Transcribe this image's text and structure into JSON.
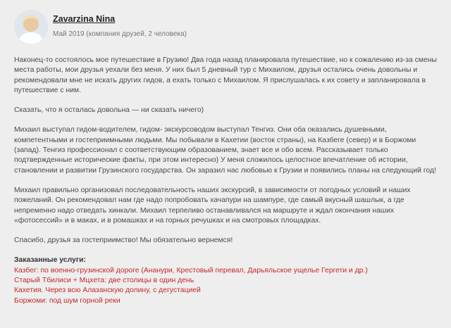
{
  "review": {
    "author": "Zavarzina Nina",
    "meta": "Май 2019 (компания друзей, 2 человека)",
    "paragraphs": [
      "Наконец-то состоялось мое путешествие в Грузию! Два года назад планировала путешествие, но к сожалению из-за смены места работы, мои друзья уехали без меня. У них был 5 дневный тур с Михаилом, друзья остались очень довольны и рекомендовали мне не искать других гидов, а ехать только с Михаилом. Я прислушалась к их совету и запланировала в путешествие с ним.",
      "Сказать, что я осталась довольна — ни сказать ничего)",
      "Михаил выступал гидом-водителем, гидом- экскурсоводом выступал Тенгиз. Они оба оказались душевными, компетентными и гостеприимными людьми. Мы побывали в Кахетии (восток страны), на Казбеге (север) и в Боржоми (запад). Тенгиз профессионал с соответствующим образованием, знает все и обо всем. Рассказывает только подтвержденные исторические факты, при этом интересно) У меня сложилось целостное впечатление об истории, становлении и развитии Грузинского государства. Он заразил нас любовью к Грузии и появились планы на следующий год!",
      "Михаил правильно организовал последовательность наших экскурсий, в зависимости от погодных условий и наших пожеланий. Он рекомендовал нам где надо попробовать хачапури на шампуре, где самый вкусный шашлык, а где непременно надо отведать хинкали. Михаил терпеливо останавливался на маршруте и ждал окончания наших «фотосессий» и в маках, и в ромашках и на горных речушках и на смотровых площадках.",
      "Спасибо, друзья за гостеприимство! Мы обязательно вернемся!"
    ],
    "services_title": "Заказанные услуги:",
    "services": [
      "Казбег: по военно-грузинской дороге (Ананури, Крестовый перевал, Дарьяльское ущелье Гергети и др.)",
      "Старый Тбилиси + Мцхета: две столицы в один день",
      "Кахетия. Через всю Алазанскую долину, с дегустацией",
      "Боржоми: под шум горной реки"
    ]
  },
  "colors": {
    "background": "#eeeeee",
    "link": "#c62828",
    "text": "#4a4a4a"
  }
}
